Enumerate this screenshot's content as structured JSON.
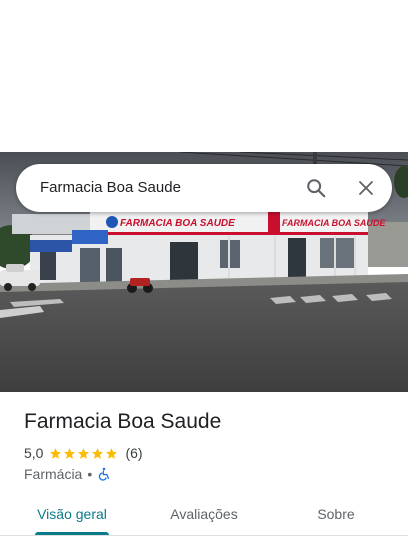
{
  "search": {
    "query": "Farmacia Boa Saude",
    "search_icon": "search-icon",
    "close_icon": "close-icon"
  },
  "photo": {
    "sign_text": "FARMACIA BOA SAUDE"
  },
  "place": {
    "title": "Farmacia Boa Saude",
    "rating": "5,0",
    "stars": 5,
    "review_count": "(6)",
    "category": "Farmácia",
    "separator": "•",
    "accessibility_icon": "wheelchair-icon"
  },
  "tabs": [
    {
      "label": "Visão geral",
      "active": true
    },
    {
      "label": "Avaliações",
      "active": false
    },
    {
      "label": "Sobre",
      "active": false
    }
  ],
  "colors": {
    "accent": "#0b7a8a",
    "star": "#fbbc04",
    "accessibility_blue": "#1a73e8",
    "sign_red": "#c8102e"
  }
}
